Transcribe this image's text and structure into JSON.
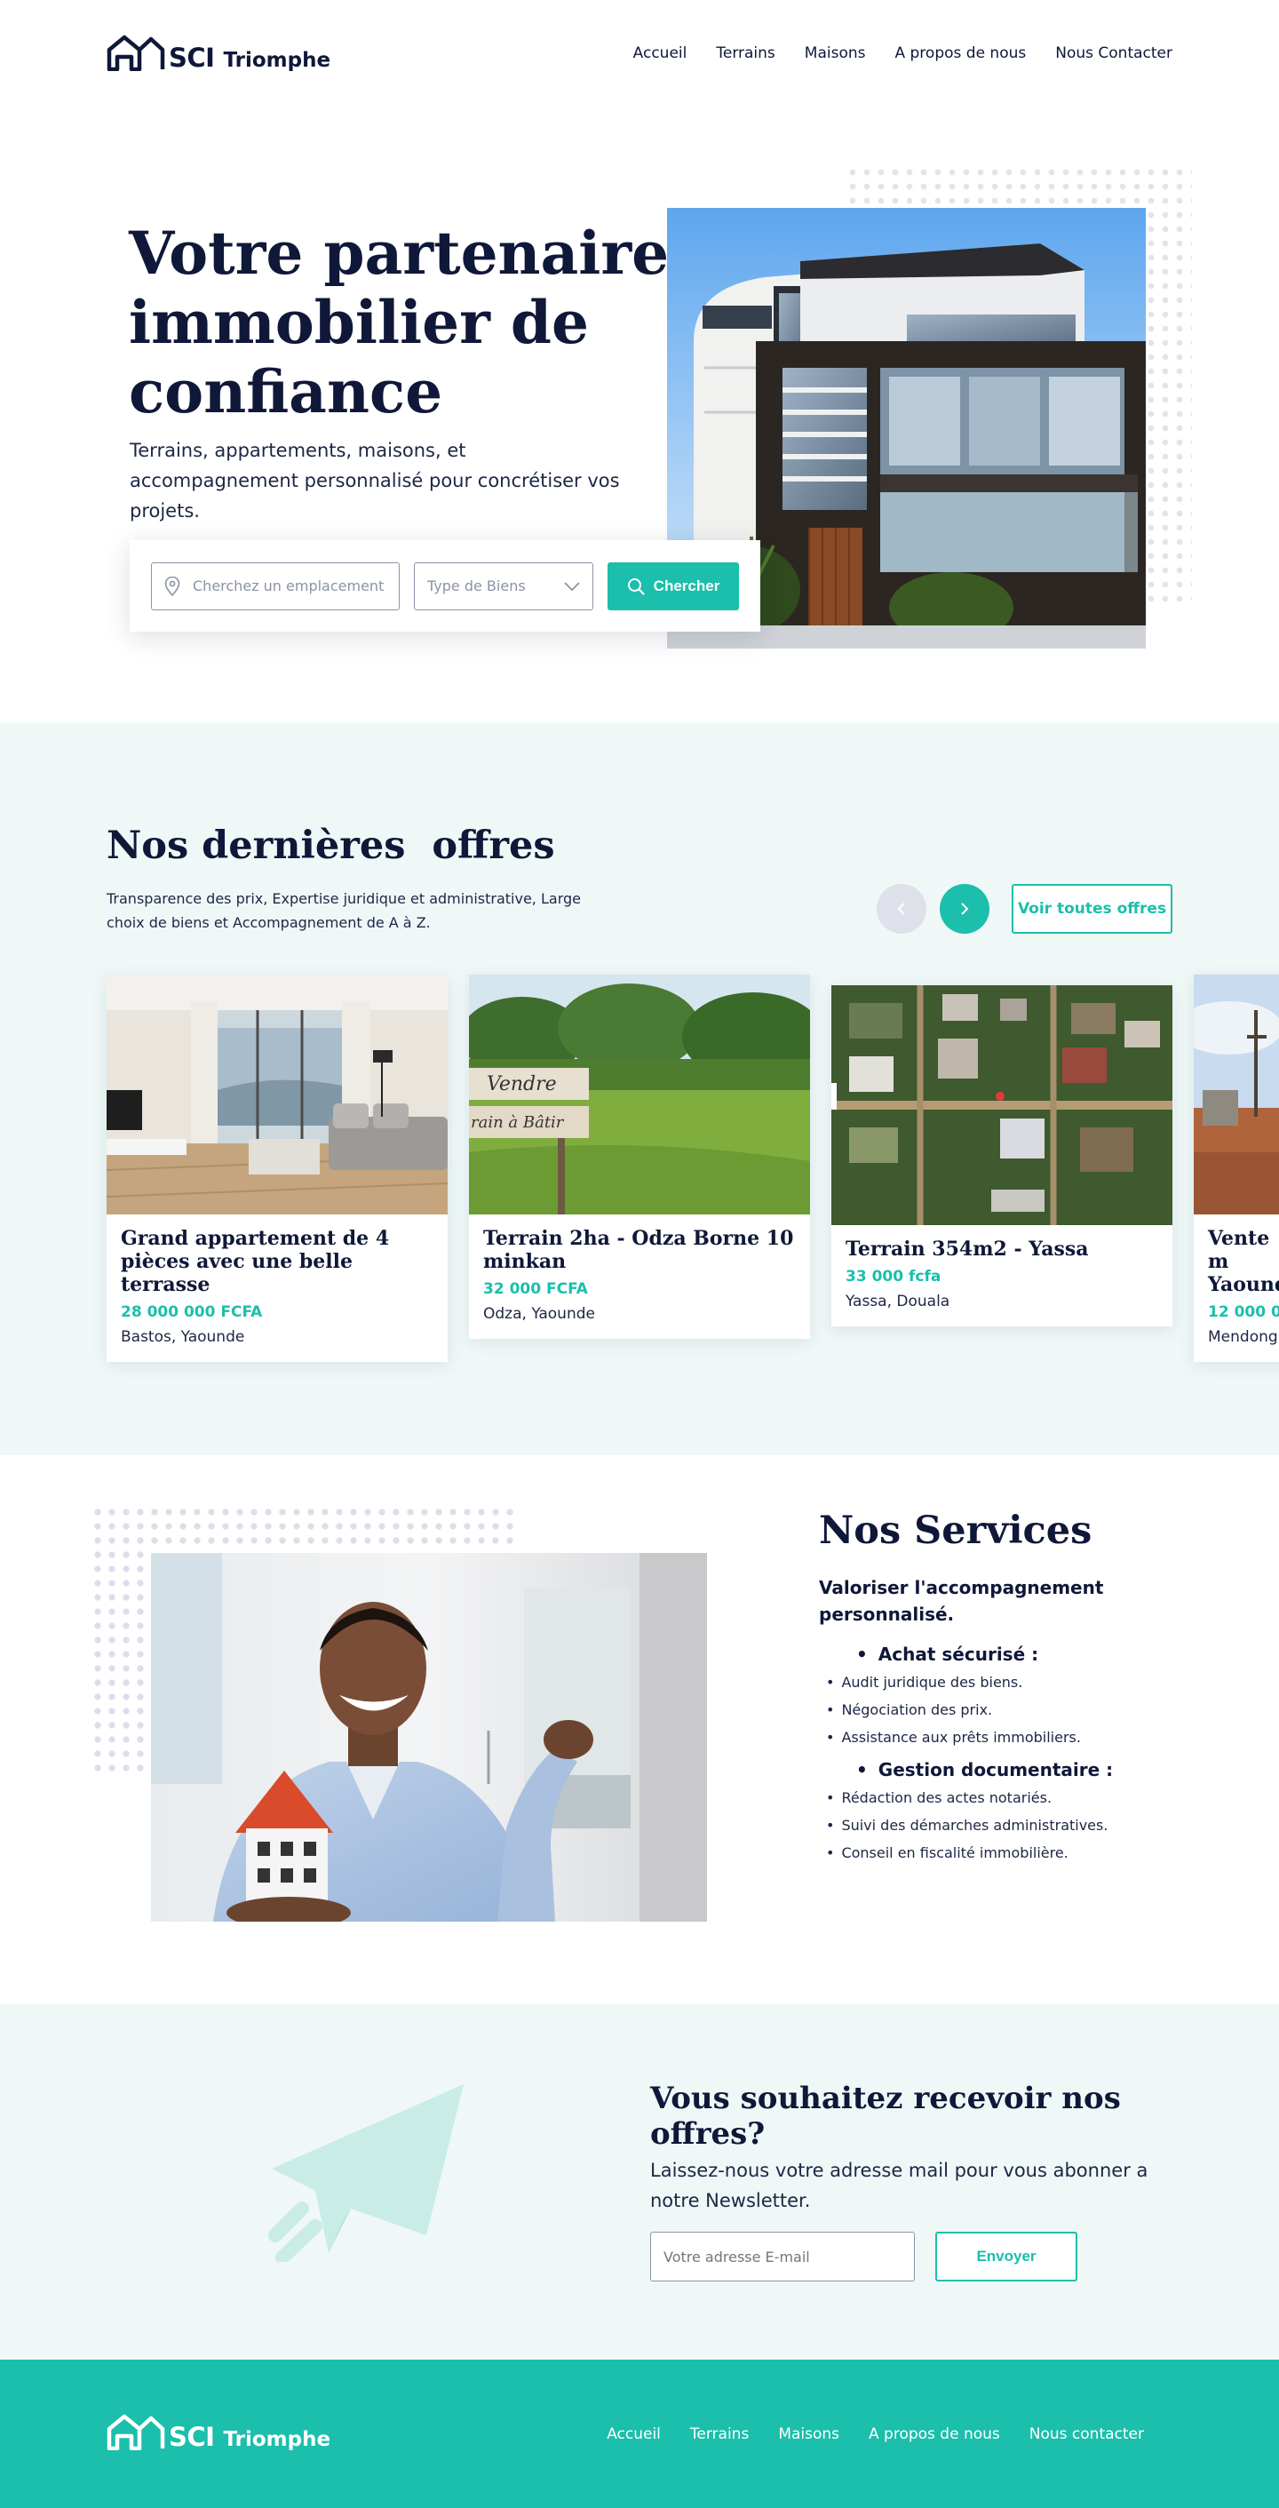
{
  "header": {
    "logo_sci": "SCI",
    "logo_name": "Triomphe",
    "nav": [
      "Accueil",
      "Terrains",
      "Maisons",
      "A propos de nous",
      "Nous Contacter"
    ]
  },
  "hero": {
    "title_lines": [
      "Votre partenaire",
      "immobilier de",
      "confiance"
    ],
    "subtitle": "Terrains, appartements, maisons, et accompagnement personnalisé pour concrétiser vos projets.",
    "search_placeholder": "Cherchez un emplacement",
    "type_select": "Type de Biens",
    "search_button": "Chercher"
  },
  "offers": {
    "title": "Nos dernières  offres",
    "subtitle": "Transparence des prix, Expertise juridique et administrative, Large choix de biens et Accompagnement de A à Z.",
    "see_all": "Voir toutes offres",
    "cards": [
      {
        "title": "Grand appartement de 4 pièces avec une belle terrasse",
        "price": "28 000 000 FCFA",
        "location": "Bastos, Yaounde"
      },
      {
        "title": "Terrain 2ha - Odza Borne 10 minkan",
        "price": "32 000 FCFA",
        "location": "Odza, Yaounde",
        "sign_line1": "Vendre",
        "sign_line2": "rain à Bâtir"
      },
      {
        "title": "Terrain 354m2 - Yassa",
        "price": "33 000 fcfa",
        "location": "Yassa, Douala"
      },
      {
        "title": "Vente m Yaound",
        "price": "12 000 00",
        "location": "Mendong,"
      }
    ]
  },
  "services": {
    "title": "Nos Services",
    "lead": "Valoriser l'accompagnement personnalisé.",
    "group1": "Achat sécurisé :",
    "group1_items": [
      "Audit juridique des biens.",
      "Négociation des prix.",
      "Assistance aux prêts immobiliers."
    ],
    "group2": "Gestion documentaire :",
    "group2_items": [
      "Rédaction des actes notariés.",
      "Suivi des démarches administratives.",
      "Conseil en fiscalité immobilière."
    ]
  },
  "newsletter": {
    "title": "Vous souhaitez recevoir nos offres?",
    "subtitle": "Laissez-nous votre adresse mail pour vous abonner a notre Newsletter.",
    "email_placeholder": "Votre adresse E-mail",
    "button": "Envoyer"
  },
  "footer": {
    "logo_sci": "SCI",
    "logo_name": "Triomphe",
    "nav": [
      "Accueil",
      "Terrains",
      "Maisons",
      "A propos de nous",
      "Nous contacter"
    ]
  },
  "colors": {
    "navy": "#0f1838",
    "teal": "#1bbfab",
    "section_bg": "#eff8f7"
  }
}
